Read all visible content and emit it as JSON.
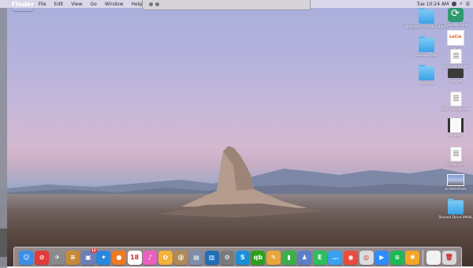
{
  "menubar": {
    "app_name": "Finder",
    "items": [
      "File",
      "Edit",
      "View",
      "Go",
      "Window",
      "Help"
    ],
    "clock": "Tue 10:24 AM"
  },
  "desktop_icons": [
    {
      "label": "Unsorted Files & Folders",
      "kind": "folder"
    },
    {
      "label": "Backup Files",
      "kind": "folder"
    },
    {
      "label": "Desktop",
      "kind": "folder"
    },
    {
      "label": "Time Machine",
      "kind": "timemachine"
    },
    {
      "label": "LaCie",
      "kind": "lacie"
    },
    {
      "label": "Untitled Folder",
      "kind": "doc"
    },
    {
      "label": "Images",
      "kind": "device"
    },
    {
      "label": "PDF Documents",
      "kind": "doc"
    },
    {
      "label": "Movies",
      "kind": "film"
    },
    {
      "label": "config.json",
      "kind": "doc"
    },
    {
      "label": "Screenshots",
      "kind": "screenshot"
    },
    {
      "label": "Shared Drive MAAL",
      "kind": "folder"
    }
  ],
  "dock": {
    "apps": [
      {
        "name": "Finder",
        "icon": "finder-icon",
        "color": "#3a8fe8",
        "glyph": "☺"
      },
      {
        "name": "Ad Block",
        "icon": "no-entry-icon",
        "color": "#e23a3a",
        "glyph": "⊘"
      },
      {
        "name": "Launchpad",
        "icon": "rocket-icon",
        "color": "#8a8a8a",
        "glyph": "✈"
      },
      {
        "name": "Notes App",
        "icon": "notebook-icon",
        "color": "#c78a3a",
        "glyph": "≡"
      },
      {
        "name": "Photo Booth",
        "icon": "photo-icon",
        "color": "#6a7fb8",
        "glyph": "▣",
        "badge": "12"
      },
      {
        "name": "Safari",
        "icon": "compass-icon",
        "color": "#2a87e0",
        "glyph": "✦"
      },
      {
        "name": "Firefox",
        "icon": "firefox-icon",
        "color": "#ef7a20",
        "glyph": "●"
      },
      {
        "name": "Calendar",
        "icon": "calendar-icon",
        "color": "#ffffff",
        "glyph": "18"
      },
      {
        "name": "iTunes",
        "icon": "music-note-icon",
        "color": "#e860c0",
        "glyph": "♪"
      },
      {
        "name": "Photos",
        "icon": "flower-icon",
        "color": "#f4b23a",
        "glyph": "✿"
      },
      {
        "name": "Contacts",
        "icon": "contacts-icon",
        "color": "#b08a5a",
        "glyph": "@"
      },
      {
        "name": "Preview",
        "icon": "preview-icon",
        "color": "#7d8ea8",
        "glyph": "▤"
      },
      {
        "name": "Trello",
        "icon": "board-icon",
        "color": "#1f6fb8",
        "glyph": "▥"
      },
      {
        "name": "System Preferences",
        "icon": "gear-icon",
        "color": "#7a7a7a",
        "glyph": "⚙"
      },
      {
        "name": "SyncMate",
        "icon": "sync-icon",
        "color": "#1a8fd8",
        "glyph": "S"
      },
      {
        "name": "QuickBooks",
        "icon": "qb-icon",
        "color": "#2ca01c",
        "glyph": "qb"
      },
      {
        "name": "Pages",
        "icon": "pages-icon",
        "color": "#e8a53a",
        "glyph": "✎"
      },
      {
        "name": "Numbers",
        "icon": "bar-chart-icon",
        "color": "#3ab04a",
        "glyph": "▮"
      },
      {
        "name": "Keynote",
        "icon": "people-icon",
        "color": "#5a7fc8",
        "glyph": "♟"
      },
      {
        "name": "Evernote",
        "icon": "elephant-icon",
        "color": "#2dbe60",
        "glyph": "E"
      },
      {
        "name": "Messages",
        "icon": "chat-bubble-icon",
        "color": "#3aa0f0",
        "glyph": "…"
      },
      {
        "name": "Google Chrome",
        "icon": "chrome-icon",
        "color": "#e94b3c",
        "glyph": "◉"
      },
      {
        "name": "Screenshot",
        "icon": "camera-icon",
        "color": "#dcdcdc",
        "glyph": "◎"
      },
      {
        "name": "Zoom",
        "icon": "video-camera-icon",
        "color": "#2d8cff",
        "glyph": "▶"
      },
      {
        "name": "Spotify",
        "icon": "spotify-icon",
        "color": "#1db954",
        "glyph": "≋"
      },
      {
        "name": "Setapp",
        "icon": "asterisk-icon",
        "color": "#f5a623",
        "glyph": "✱"
      }
    ],
    "right": [
      {
        "name": "Documents Stack",
        "icon": "document-icon",
        "color": "#f2f2f2",
        "glyph": ""
      },
      {
        "name": "Trash",
        "icon": "trash-icon",
        "color": "#d8d8d8",
        "glyph": "🗑"
      }
    ]
  }
}
